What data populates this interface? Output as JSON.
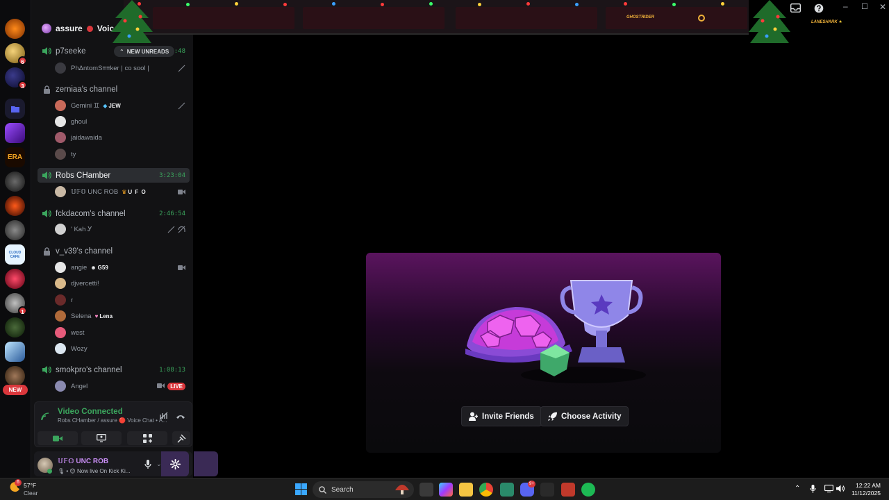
{
  "server": {
    "name": "assure",
    "section": "Voice"
  },
  "rail": {
    "badges": [
      "6",
      "3",
      "1"
    ],
    "new_label": "NEW",
    "era_label": "ERA",
    "cafe_label": "CLOUD CAFE"
  },
  "new_unreads": "NEW UNREADS",
  "channels": [
    {
      "name": "p7seeke",
      "time": "6:45:48",
      "users": [
        {
          "name": "PhΔntomS≡≡ker | co sool |"
        }
      ]
    },
    {
      "name": "zerniaa's channel",
      "locked": true,
      "users": [
        {
          "name": "Gemini ♊",
          "tag": "JEW"
        },
        {
          "name": "ghoul"
        },
        {
          "name": "jaidawaida"
        },
        {
          "name": "ty"
        }
      ]
    },
    {
      "name": "Robs CHamber",
      "time": "3:23:04",
      "users": [
        {
          "name": "𝕌𝔽𝕆 UNC ROB",
          "tag": "U F O"
        }
      ]
    },
    {
      "name": "fckdacom's channel",
      "time": "2:46:54",
      "users": [
        {
          "name": "' Kah Ꭹ"
        }
      ]
    },
    {
      "name": "v_v39's channel",
      "locked": true,
      "users": [
        {
          "name": "angie",
          "tag": "G59"
        },
        {
          "name": "djvercetti!"
        },
        {
          "name": "r"
        },
        {
          "name": "Selena",
          "tag": "Lena"
        },
        {
          "name": "west"
        },
        {
          "name": "Wozy"
        }
      ]
    },
    {
      "name": "smokpro's channel",
      "time": "1:08:13",
      "users": [
        {
          "name": "Angel",
          "live": "LIVE"
        }
      ]
    }
  ],
  "voice": {
    "status": "Video Connected",
    "detail": "Robs CHamber / assure 🔴 Voice Chat • A..."
  },
  "me": {
    "name": "𝕌𝔽𝕆 UNC ROB",
    "status": "Now live On Kick Ki..."
  },
  "banner": {
    "slot_text": "GHOSTRIDER",
    "right_text": "LANESHARK"
  },
  "activity": {
    "invite_label": "Invite Friends",
    "choose_label": "Choose Activity"
  },
  "taskbar": {
    "weather_badge": "6",
    "temp": "57°F",
    "condition": "Clear",
    "search_placeholder": "Search",
    "discord_badge": "9+",
    "time": "12:22 AM",
    "date": "11/12/2025"
  },
  "colors": {
    "accent_green": "#3ba55d",
    "live_red": "#da373c",
    "brand_purple": "#5a145e"
  }
}
